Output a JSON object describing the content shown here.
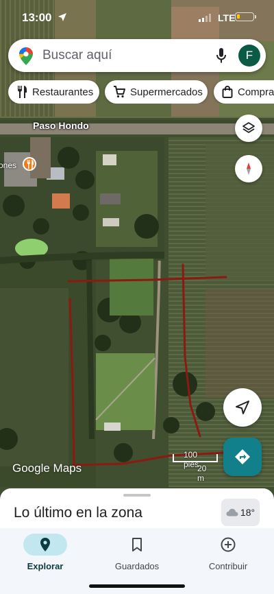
{
  "status_bar": {
    "time": "13:00",
    "network": "LTE"
  },
  "search": {
    "placeholder": "Buscar aquí",
    "avatar_initial": "F"
  },
  "chips": [
    {
      "label": "Restaurantes",
      "icon": "restaurant-icon"
    },
    {
      "label": "Supermercados",
      "icon": "shopping-cart-icon"
    },
    {
      "label": "Compras",
      "icon": "shopping-bag-icon"
    }
  ],
  "map": {
    "road_label": "Paso Hondo",
    "poi_label_fragment": "ones",
    "logo": "Google Maps",
    "scale": {
      "feet": "100 pies",
      "meters": "20 m"
    },
    "annotation_color": "#8b1a12"
  },
  "controls": {
    "layers": "layers-icon",
    "compass": "compass-icon",
    "my_location": "navigation-arrow-icon",
    "directions": "directions-icon"
  },
  "sheet": {
    "title": "Lo último en la zona",
    "weather": "18°"
  },
  "bottom_nav": [
    {
      "label": "Explorar",
      "icon": "explore-pin-icon",
      "active": true
    },
    {
      "label": "Guardados",
      "icon": "bookmark-icon",
      "active": false
    },
    {
      "label": "Contribuir",
      "icon": "add-circle-icon",
      "active": false
    }
  ],
  "colors": {
    "accent": "#11808b",
    "avatar": "#0b5a45",
    "explore_pill": "#c2e7ef"
  }
}
